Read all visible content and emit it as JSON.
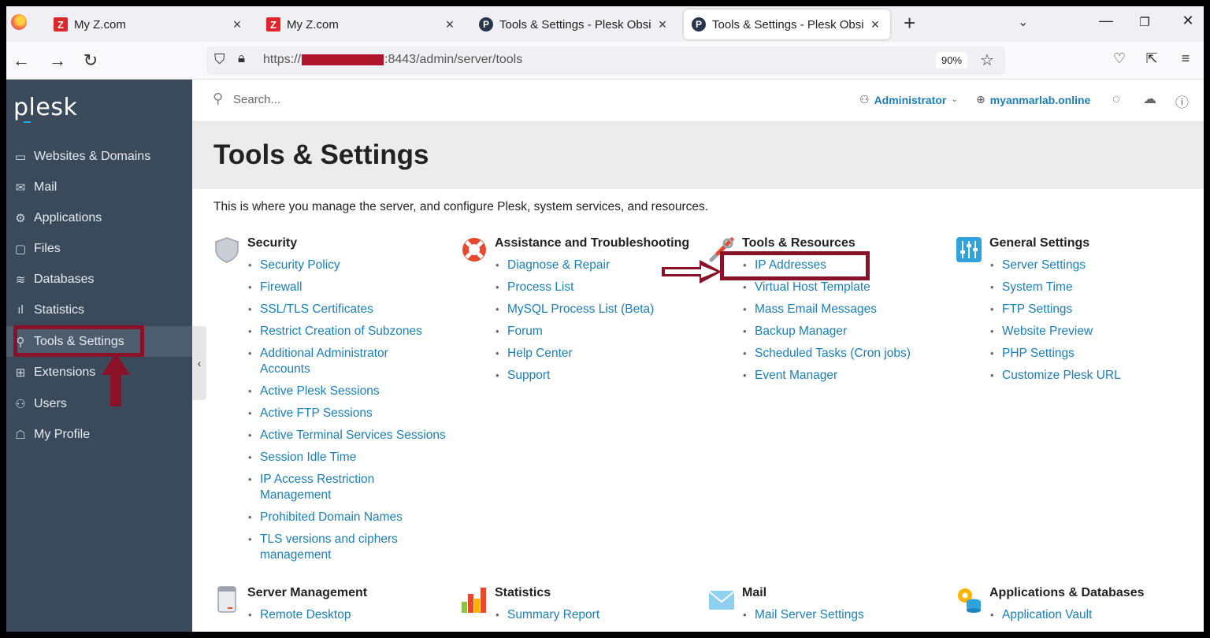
{
  "browser": {
    "tabs": [
      {
        "title": "My Z.com",
        "favicon": "z-logo-icon",
        "close": "×"
      },
      {
        "title": "My Z.com",
        "favicon": "z-logo-icon",
        "close": "×"
      },
      {
        "title": "Tools & Settings - Plesk Obsidia",
        "favicon": "plesk-p-icon",
        "close": "×"
      },
      {
        "title": "Tools & Settings - Plesk Obsidia",
        "favicon": "plesk-p-icon",
        "close": "×"
      }
    ],
    "url": {
      "prefix": "https://",
      "suffix": ":8443/admin/server/tools"
    },
    "zoom": "90%"
  },
  "sidebar": {
    "brand": "plesk",
    "items": [
      {
        "label": "Websites & Domains",
        "icon": "monitor-icon"
      },
      {
        "label": "Mail",
        "icon": "mail-icon"
      },
      {
        "label": "Applications",
        "icon": "gear-icon"
      },
      {
        "label": "Files",
        "icon": "folder-icon"
      },
      {
        "label": "Databases",
        "icon": "database-icon"
      },
      {
        "label": "Statistics",
        "icon": "bar-chart-icon"
      },
      {
        "label": "Tools & Settings",
        "icon": "sliders-icon",
        "active": true
      },
      {
        "label": "Extensions",
        "icon": "extensions-icon"
      },
      {
        "label": "Users",
        "icon": "user-icon"
      },
      {
        "label": "My Profile",
        "icon": "profile-icon"
      }
    ]
  },
  "topbar": {
    "search_placeholder": "Search...",
    "user": "Administrator",
    "domain": "myanmarlab.online"
  },
  "page": {
    "title": "Tools & Settings",
    "description": "This is where you manage the server, and configure Plesk, system services, and resources."
  },
  "groups": [
    {
      "title": "Security",
      "icon": "shield-icon",
      "items": [
        "Security Policy",
        "Firewall",
        "SSL/TLS Certificates",
        "Restrict Creation of Subzones",
        "Additional Administrator Accounts",
        "Active Plesk Sessions",
        "Active FTP Sessions",
        "Active Terminal Services Sessions",
        "Session Idle Time",
        "IP Access Restriction Management",
        "Prohibited Domain Names",
        "TLS versions and ciphers management"
      ]
    },
    {
      "title": "Assistance and Troubleshooting",
      "icon": "lifebuoy-icon",
      "items": [
        "Diagnose & Repair",
        "Process List",
        "MySQL Process List (Beta)",
        "Forum",
        "Help Center",
        "Support"
      ]
    },
    {
      "title": "Tools & Resources",
      "icon": "tools-icon",
      "items": [
        "IP Addresses",
        "Virtual Host Template",
        "Mass Email Messages",
        "Backup Manager",
        "Scheduled Tasks (Cron jobs)",
        "Event Manager"
      ]
    },
    {
      "title": "General Settings",
      "icon": "sliders-icon",
      "items": [
        "Server Settings",
        "System Time",
        "FTP Settings",
        "Website Preview",
        "PHP Settings",
        "Customize Plesk URL"
      ]
    },
    {
      "title": "Server Management",
      "icon": "server-icon",
      "items": [
        "Remote Desktop"
      ]
    },
    {
      "title": "Statistics",
      "icon": "bar-chart-icon",
      "items": [
        "Summary Report"
      ]
    },
    {
      "title": "Mail",
      "icon": "envelope-icon",
      "items": [
        "Mail Server Settings"
      ]
    },
    {
      "title": "Applications & Databases",
      "icon": "apps-db-icon",
      "items": [
        "Application Vault"
      ]
    }
  ],
  "colors": {
    "annotation": "#8a1228",
    "link": "#1a7fb8",
    "sidebar": "#3a4a5b"
  }
}
